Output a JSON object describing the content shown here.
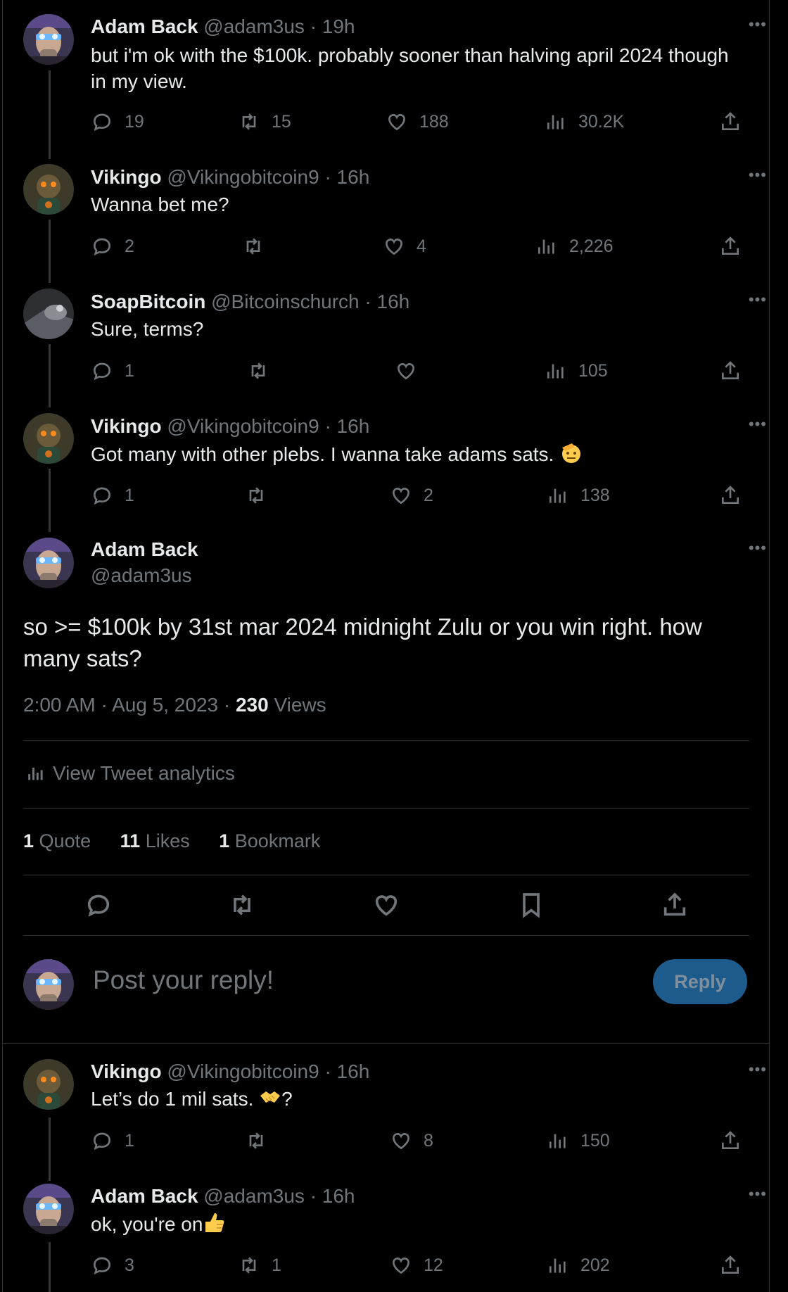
{
  "tweets_above": [
    {
      "name": "Adam Back",
      "handle": "@adam3us",
      "time": "· 19h",
      "text": "but i'm ok with the $100k. probably sooner than halving april 2024 though in my view.",
      "replies": "19",
      "retweets": "15",
      "likes": "188",
      "views": "30.2K"
    },
    {
      "name": "Vikingo",
      "handle": "@Vikingobitcoin9",
      "time": "· 16h",
      "text": "Wanna bet me?",
      "replies": "2",
      "retweets": "",
      "likes": "4",
      "views": "2,226"
    },
    {
      "name": "SoapBitcoin",
      "handle": "@Bitcoinschurch",
      "time": "· 16h",
      "text": "Sure, terms?",
      "replies": "1",
      "retweets": "",
      "likes": "",
      "views": "105"
    },
    {
      "name": "Vikingo",
      "handle": "@Vikingobitcoin9",
      "time": "· 16h",
      "text": "Got many with other plebs. I wanna take adams sats.",
      "replies": "1",
      "retweets": "",
      "likes": "2",
      "views": "138"
    }
  ],
  "focus": {
    "name": "Adam Back",
    "handle": "@adam3us",
    "text": "so >= $100k by 31st mar 2024 midnight Zulu or you win right. how many sats?",
    "timestamp": "2:00 AM · Aug 5, 2023 · ",
    "views_count": "230",
    "views_label": " Views",
    "analytics_label": "View Tweet analytics",
    "quotes_count": "1",
    "quotes_label": "Quote",
    "likes_count": "11",
    "likes_label": "Likes",
    "bookmarks_count": "1",
    "bookmarks_label": "Bookmark"
  },
  "composer": {
    "placeholder": "Post your reply!",
    "button": "Reply"
  },
  "tweets_below": [
    {
      "name": "Vikingo",
      "handle": "@Vikingobitcoin9",
      "time": "· 16h",
      "text": "Let’s do 1 mil sats.",
      "text_suffix": "?",
      "replies": "1",
      "retweets": "",
      "likes": "8",
      "views": "150"
    },
    {
      "name": "Adam Back",
      "handle": "@adam3us",
      "time": "· 16h",
      "text": "ok, you're on",
      "replies": "3",
      "retweets": "1",
      "likes": "12",
      "views": "202"
    }
  ],
  "colors": {
    "accent": "#1d9bf0",
    "muted": "#71767b",
    "text": "#e7e9ea",
    "reply_button": "#1d5b8c"
  },
  "icons": [
    "reply-icon",
    "retweet-icon",
    "like-icon",
    "views-icon",
    "share-icon",
    "bookmark-icon",
    "more-icon"
  ]
}
